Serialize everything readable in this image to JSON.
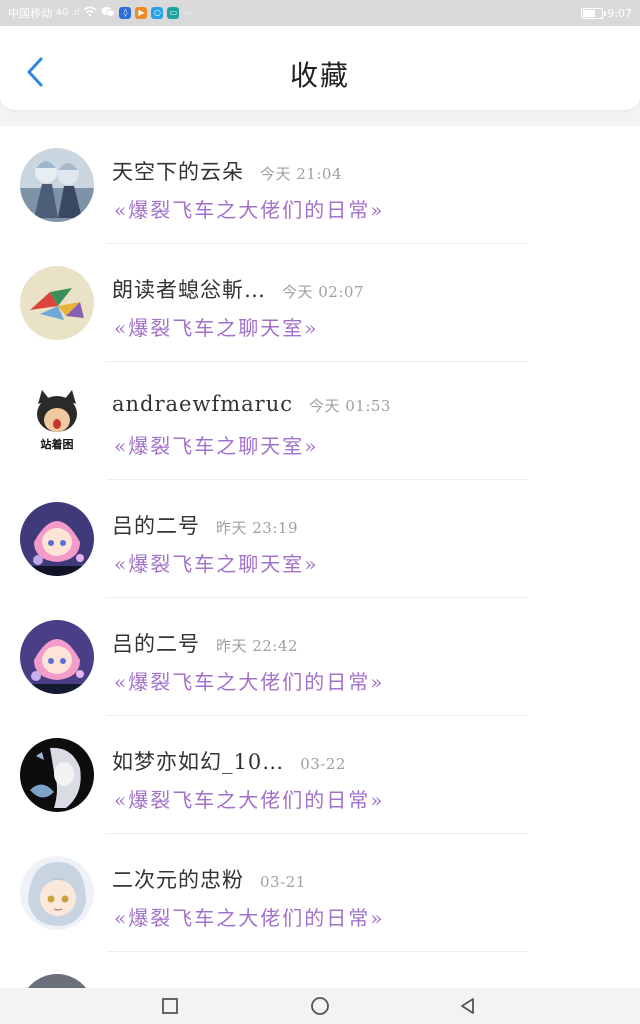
{
  "status_bar": {
    "carrier": "中国移动",
    "signal": "4G .ıl",
    "time": "9:07",
    "icons": [
      "wifi-icon",
      "wechat-icon",
      "app-blue-icon",
      "app-orange-icon",
      "app-search-icon",
      "app-teal-icon",
      "more-dots-icon",
      "battery-icon"
    ]
  },
  "header": {
    "title": "收藏",
    "back_icon": "chevron-left-icon",
    "accent": "#2e86de"
  },
  "favorites": [
    {
      "name": "天空下的云朵",
      "time": "今天 21:04",
      "group": "«爆裂飞车之大佬们的日常»",
      "avatar": "anime-duo-avatar"
    },
    {
      "name": "朗读者螅忩斬…",
      "time": "今天 02:07",
      "group": "«爆裂飞车之聊天室»",
      "avatar": "paper-crane-avatar"
    },
    {
      "name": "andraewfmaruc",
      "time": "今天 01:53",
      "group": "«爆裂飞车之聊天室»",
      "avatar": "cat-mask-avatar",
      "avatar_caption": "站着困"
    },
    {
      "name": "吕的二号",
      "time": "昨天 23:19",
      "group": "«爆裂飞车之聊天室»",
      "avatar": "pink-hair-avatar"
    },
    {
      "name": "吕的二号",
      "time": "昨天 22:42",
      "group": "«爆裂飞车之大佬们的日常»",
      "avatar": "pink-hair-avatar"
    },
    {
      "name": "如梦亦如幻_10…",
      "time": "03-22",
      "group": "«爆裂飞车之大佬们的日常»",
      "avatar": "monochrome-girl-avatar"
    },
    {
      "name": "二次元的忠粉",
      "time": "03-21",
      "group": "«爆裂飞车之大佬们的日常»",
      "avatar": "silver-hair-avatar"
    }
  ],
  "nav": {
    "recent_icon": "square-icon",
    "home_icon": "circle-icon",
    "back_icon": "triangle-back-icon"
  },
  "colors": {
    "group_text": "#a271c9",
    "name_text": "#333333",
    "time_text": "#a0a0a0"
  }
}
